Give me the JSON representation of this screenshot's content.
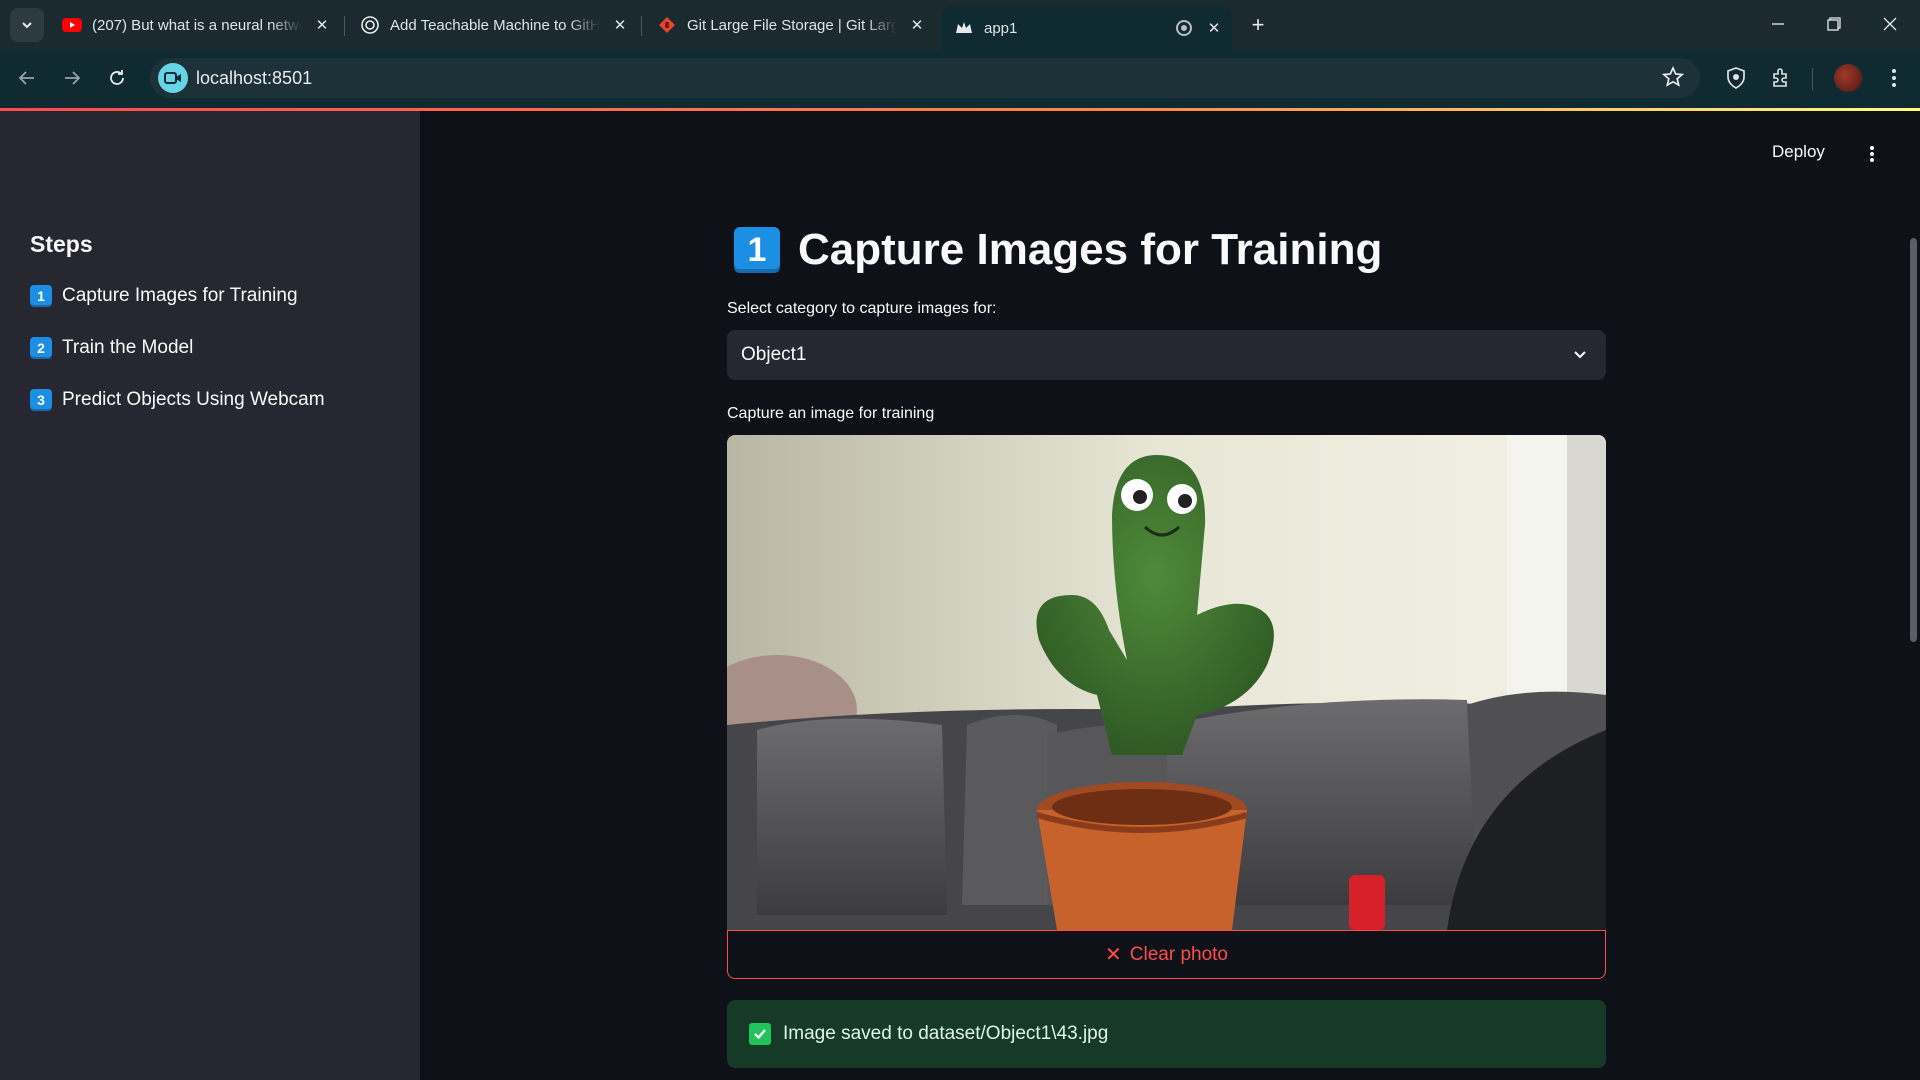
{
  "browser": {
    "tabs": [
      {
        "title": "(207) But what is a neural netwo",
        "favicon": "youtube-icon"
      },
      {
        "title": "Add Teachable Machine to GitHub",
        "favicon": "openai-icon"
      },
      {
        "title": "Git Large File Storage | Git Large",
        "favicon": "git-lfs-icon"
      },
      {
        "title": "app1",
        "favicon": "streamlit-crown-icon",
        "active": true
      }
    ],
    "url": "localhost:8501"
  },
  "app": {
    "deploy_label": "Deploy",
    "sidebar": {
      "heading": "Steps",
      "items": [
        {
          "num": "1",
          "label": "Capture Images for Training"
        },
        {
          "num": "2",
          "label": "Train the Model"
        },
        {
          "num": "3",
          "label": "Predict Objects Using Webcam"
        }
      ]
    },
    "main": {
      "title_num": "1",
      "title": "Capture Images for Training",
      "select_label": "Select category to capture images for:",
      "select_value": "Object1",
      "camera_label": "Capture an image for training",
      "clear_label": "Clear photo",
      "success_message": "Image saved to dataset/Object1\\43.jpg"
    },
    "colors": {
      "accent": "#ff4b4b",
      "keycap": "#1c8fe5",
      "success_bg": "#173928",
      "sidebar_bg": "#262730",
      "main_bg": "#0e1117"
    }
  }
}
